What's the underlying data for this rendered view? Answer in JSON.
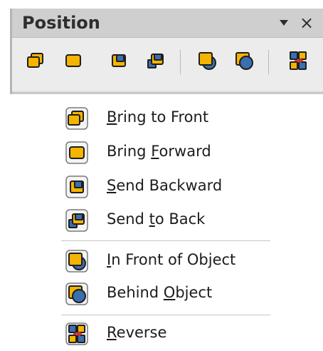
{
  "toolbar": {
    "title": "Position",
    "menu_icon": "dropdown-arrow-icon",
    "close_icon": "close-icon",
    "buttons": [
      {
        "name": "bring-to-front-button",
        "icon": "bring-to-front-icon"
      },
      {
        "name": "bring-forward-button",
        "icon": "bring-forward-icon"
      },
      {
        "name": "send-backward-button",
        "icon": "send-backward-icon"
      },
      {
        "name": "send-to-back-button",
        "icon": "send-to-back-icon"
      },
      {
        "name": "in-front-of-object-button",
        "icon": "in-front-of-object-icon"
      },
      {
        "name": "behind-object-button",
        "icon": "behind-object-icon"
      },
      {
        "name": "reverse-button",
        "icon": "reverse-icon"
      }
    ]
  },
  "menu": {
    "items": [
      {
        "pre": "",
        "key": "B",
        "post": "ring to Front",
        "icon": "bring-to-front-icon"
      },
      {
        "pre": "Bring ",
        "key": "F",
        "post": "orward",
        "icon": "bring-forward-icon"
      },
      {
        "pre": "",
        "key": "S",
        "post": "end Backward",
        "icon": "send-backward-icon"
      },
      {
        "pre": "Send ",
        "key": "t",
        "post": "o Back",
        "icon": "send-to-back-icon"
      },
      {
        "pre": "",
        "key": "I",
        "post": "n Front of Object",
        "icon": "in-front-of-object-icon"
      },
      {
        "pre": "Behind ",
        "key": "O",
        "post": "bject",
        "icon": "behind-object-icon"
      },
      {
        "pre": "",
        "key": "R",
        "post": "everse",
        "icon": "reverse-icon"
      }
    ]
  },
  "colors": {
    "orange": "#f5b400",
    "blue": "#3a6fb0",
    "title_bg": "#cfcfcf",
    "toolbar_bg": "#ececec"
  }
}
